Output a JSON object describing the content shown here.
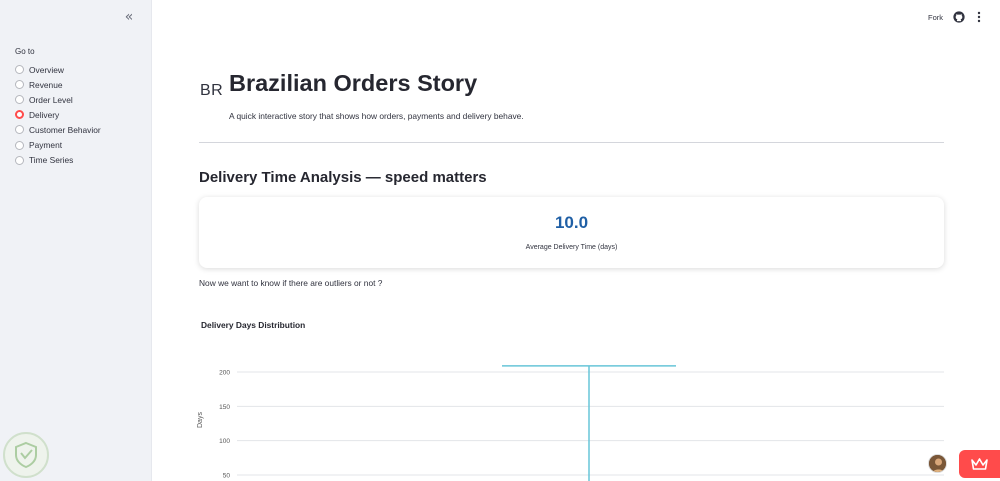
{
  "sidebar": {
    "collapse_icon": "chevron-double-left-icon",
    "goto_label": "Go to",
    "items": [
      {
        "label": "Overview",
        "selected": false
      },
      {
        "label": "Revenue",
        "selected": false
      },
      {
        "label": "Order Level",
        "selected": false
      },
      {
        "label": "Delivery",
        "selected": true
      },
      {
        "label": "Customer Behavior",
        "selected": false
      },
      {
        "label": "Payment",
        "selected": false
      },
      {
        "label": "Time Series",
        "selected": false
      }
    ]
  },
  "header": {
    "fork_label": "Fork",
    "github_icon": "github-icon",
    "menu_icon": "kebab-menu-icon"
  },
  "main": {
    "title_prefix": "BR",
    "title": "Brazilian Orders Story",
    "subtitle": "A quick interactive story that shows how orders, payments and delivery behave.",
    "section_title": "Delivery Time Analysis — speed matters",
    "metric": {
      "value": "10.0",
      "label": "Average Delivery Time (days)"
    },
    "question": "Now we want to know if there are outliers or not ?"
  },
  "colors": {
    "accent": "#ff4b4b",
    "metric_value": "#1f5fa5",
    "box_line": "#67c5d8"
  },
  "chart_data": {
    "type": "box",
    "title": "Delivery Days Distribution",
    "xlabel": "",
    "ylabel": "Days",
    "yticks": [
      50,
      100,
      150,
      200
    ],
    "visible_ylim": [
      45,
      210
    ],
    "upper_fence": 209,
    "grid": true
  }
}
